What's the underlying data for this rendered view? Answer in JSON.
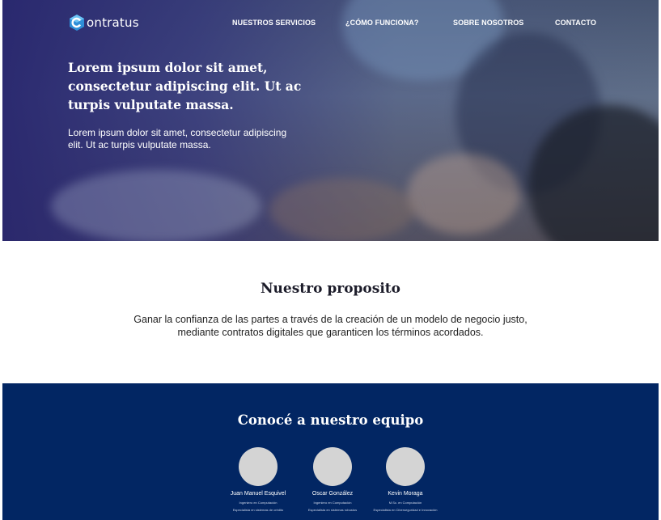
{
  "brand": {
    "logo_text": "ontratus",
    "logo_icon": "hexagon-c-logo-icon"
  },
  "nav": {
    "items": [
      {
        "label": "NUESTROS SERVICIOS"
      },
      {
        "label": "¿CÓMO FUNCIONA?"
      },
      {
        "label": "SOBRE NOSOTROS"
      },
      {
        "label": "CONTACTO"
      }
    ]
  },
  "hero": {
    "title": "Lorem ipsum dolor sit amet, consectetur adipiscing elit. Ut ac turpis vulputate massa.",
    "subtitle": "Lorem ipsum dolor sit amet, consectetur adipiscing elit. Ut ac turpis vulputate massa."
  },
  "purpose": {
    "title": "Nuestro proposito",
    "text": "Ganar la confianza de las partes a través de la creación de un modelo de negocio justo, mediante contratos digitales que garanticen los términos acordados."
  },
  "team": {
    "title": "Conocé a nuestro equipo",
    "members": [
      {
        "name": "Juan Manuel Esquivel",
        "role": "Ingeniero en Computación",
        "specialty": "Especialista en sistemas de crédito"
      },
      {
        "name": "Oscar González",
        "role": "Ingeniero en Computación",
        "specialty": "Especialista en sistemas robustos"
      },
      {
        "name": "Kevin Moraga",
        "role": "M.Sc. en Computación",
        "specialty": "Especialista en Ciberseguridad e Innovación"
      }
    ]
  },
  "colors": {
    "team_background": "#022663",
    "hero_overlay": "#28266e",
    "avatar_placeholder": "#d4d4d4"
  }
}
